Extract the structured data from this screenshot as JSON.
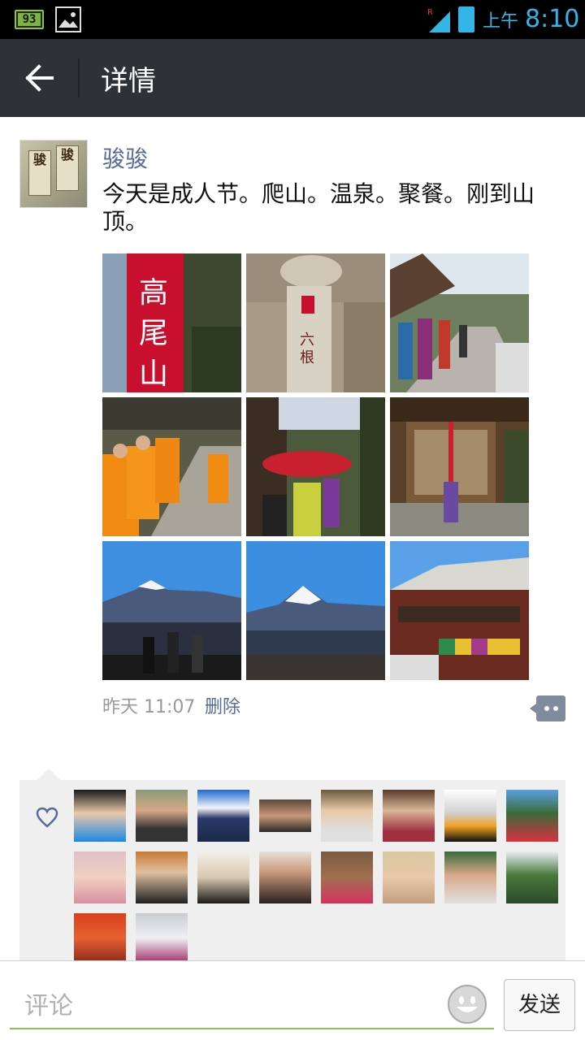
{
  "status_bar": {
    "battery_level": "93",
    "time_prefix": "上午",
    "time": "8:10",
    "colors": {
      "accent": "#33b5e5",
      "battery": "#7cb342"
    }
  },
  "header": {
    "title": "详情",
    "background": "#2d3236"
  },
  "post": {
    "username": "骏骏",
    "avatar_tags": [
      "骏",
      "骏"
    ],
    "text": "今天是成人节。爬山。温泉。聚餐。刚到山顶。",
    "photos": [
      {
        "icon": "temple-banner-photo"
      },
      {
        "icon": "stone-lantern-photo"
      },
      {
        "icon": "hikers-path-photo"
      },
      {
        "icon": "monks-procession-photo"
      },
      {
        "icon": "red-umbrella-procession-photo"
      },
      {
        "icon": "shrine-gate-photo"
      },
      {
        "icon": "mount-fuji-crowd-photo"
      },
      {
        "icon": "mount-fuji-view-photo"
      },
      {
        "icon": "temple-roof-photo"
      }
    ],
    "time": "昨天 11:07",
    "delete_label": "删除"
  },
  "likes": {
    "count_shown": 18,
    "link_color": "#576b95"
  },
  "comment_bar": {
    "placeholder": "评论",
    "send_label": "发送"
  }
}
